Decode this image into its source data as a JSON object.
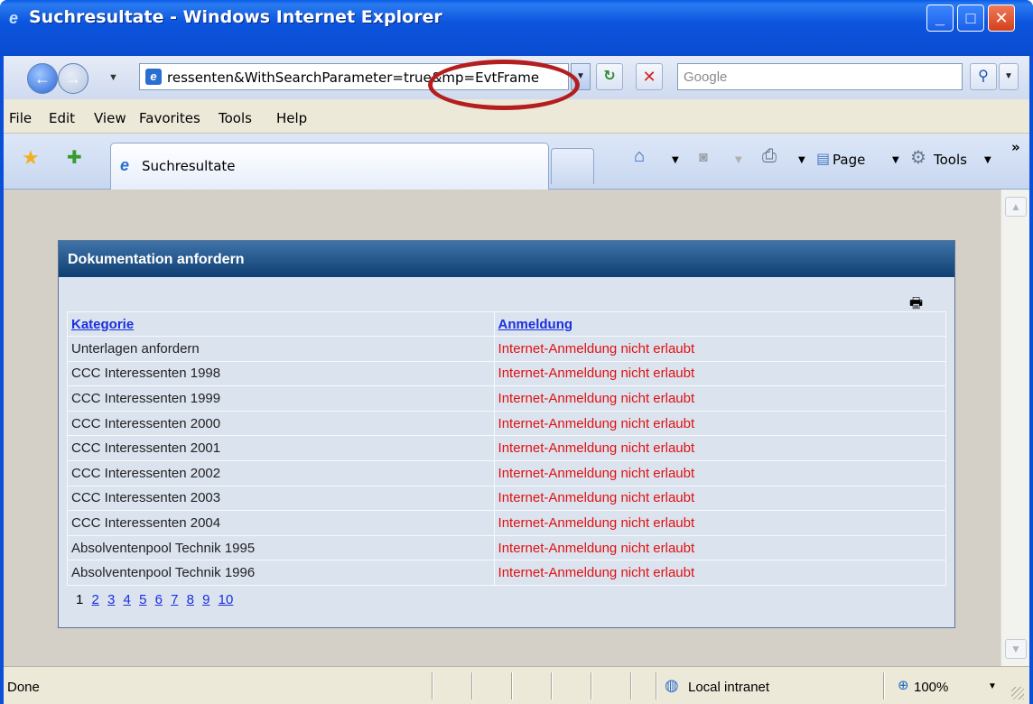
{
  "window": {
    "title": "Suchresultate - Windows Internet Explorer"
  },
  "toolbar": {
    "address": "ressenten&WithSearchParameter=true&mp=EvtFrame",
    "search_placeholder": "Google"
  },
  "menu": [
    "File",
    "Edit",
    "View",
    "Favorites",
    "Tools",
    "Help"
  ],
  "tabs": {
    "active": "Suchresultate"
  },
  "commandbar": {
    "page": "Page",
    "tools": "Tools"
  },
  "panel": {
    "title": "Dokumentation anfordern",
    "columns": [
      "Kategorie",
      "Anmeldung"
    ],
    "rows": [
      {
        "kategorie": "Unterlagen anfordern",
        "anmeldung": "Internet-Anmeldung nicht erlaubt"
      },
      {
        "kategorie": "CCC Interessenten 1998",
        "anmeldung": "Internet-Anmeldung nicht erlaubt"
      },
      {
        "kategorie": "CCC Interessenten 1999",
        "anmeldung": "Internet-Anmeldung nicht erlaubt"
      },
      {
        "kategorie": "CCC Interessenten 2000",
        "anmeldung": "Internet-Anmeldung nicht erlaubt"
      },
      {
        "kategorie": "CCC Interessenten 2001",
        "anmeldung": "Internet-Anmeldung nicht erlaubt"
      },
      {
        "kategorie": "CCC Interessenten 2002",
        "anmeldung": "Internet-Anmeldung nicht erlaubt"
      },
      {
        "kategorie": "CCC Interessenten 2003",
        "anmeldung": "Internet-Anmeldung nicht erlaubt"
      },
      {
        "kategorie": "CCC Interessenten 2004",
        "anmeldung": "Internet-Anmeldung nicht erlaubt"
      },
      {
        "kategorie": "Absolventenpool Technik 1995",
        "anmeldung": "Internet-Anmeldung nicht erlaubt"
      },
      {
        "kategorie": "Absolventenpool Technik 1996",
        "anmeldung": "Internet-Anmeldung nicht erlaubt"
      }
    ],
    "pager": {
      "current": "1",
      "pages": [
        "2",
        "3",
        "4",
        "5",
        "6",
        "7",
        "8",
        "9",
        "10"
      ]
    }
  },
  "status": {
    "text": "Done",
    "zone": "Local intranet",
    "zoom": "100%"
  },
  "colors": {
    "link": "#1a2fe0",
    "error": "#e01010",
    "header": "#1f4f86"
  },
  "icons": [
    "ie-logo-icon",
    "back-arrow-icon",
    "forward-arrow-icon",
    "refresh-icon",
    "stop-icon",
    "search-icon",
    "star-icon",
    "add-favorite-icon",
    "home-icon",
    "feed-icon",
    "print-icon",
    "page-icon",
    "gear-icon",
    "printer-icon",
    "intranet-icon",
    "zoom-icon"
  ]
}
